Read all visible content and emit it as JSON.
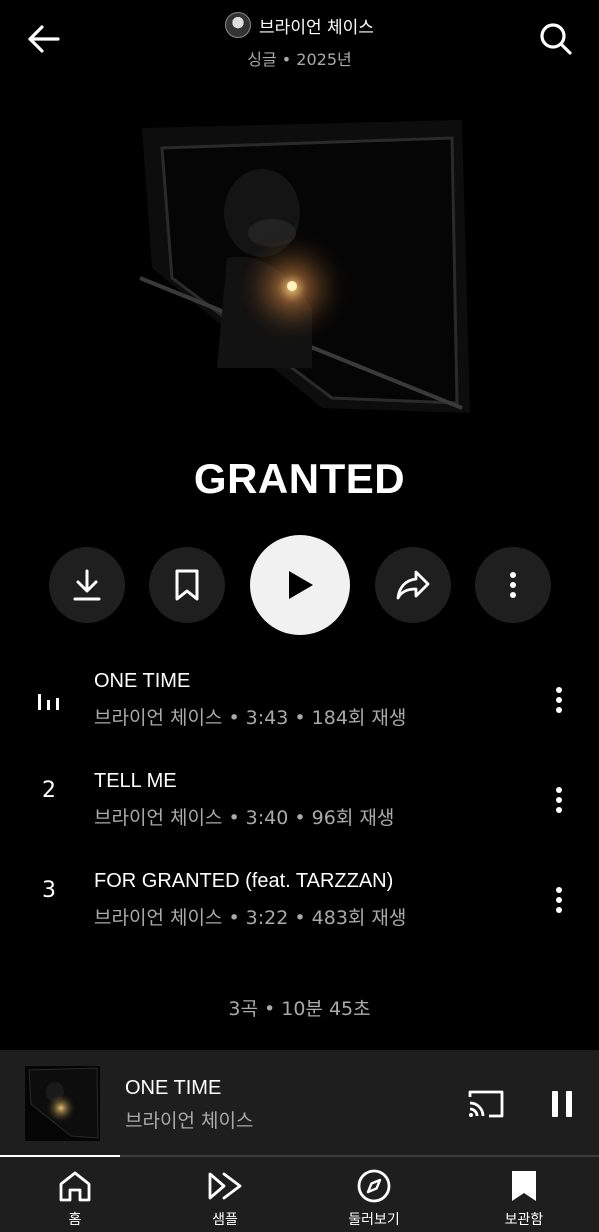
{
  "header": {
    "artist": "브라이언 체이스",
    "subtitle": "싱글 • 2025년"
  },
  "album": {
    "title": "GRANTED"
  },
  "tracks": [
    {
      "number": "",
      "title": "ONE TIME",
      "meta": "브라이언 체이스 • 3:43 • 184회 재생",
      "playing": true
    },
    {
      "number": "2",
      "title": "TELL ME",
      "meta": "브라이언 체이스 • 3:40 • 96회 재생",
      "playing": false
    },
    {
      "number": "3",
      "title": "FOR GRANTED (feat. TARZZAN)",
      "meta": "브라이언 체이스 • 3:22 • 483회 재생",
      "playing": false
    }
  ],
  "summary": "3곡 • 10분 45초",
  "mini_player": {
    "title": "ONE TIME",
    "artist": "브라이언 체이스",
    "progress": 0.2
  },
  "nav": [
    {
      "label": "홈",
      "icon": "home-icon",
      "active": false
    },
    {
      "label": "샘플",
      "icon": "samples-icon",
      "active": false
    },
    {
      "label": "둘러보기",
      "icon": "explore-icon",
      "active": false
    },
    {
      "label": "보관함",
      "icon": "library-icon",
      "active": true
    }
  ],
  "colors": {
    "background": "#000000",
    "secondary_text": "#aaaaaa",
    "button_bg": "#1f1f1f",
    "play_bg": "#f1f1f1"
  }
}
